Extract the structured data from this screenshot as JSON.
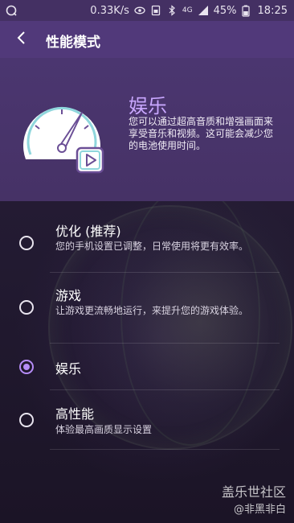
{
  "status_bar": {
    "speed": "0.33K/s",
    "network": "4G",
    "battery": "45%",
    "time": "18:25",
    "icons": [
      "app-notification-icon",
      "eye-icon",
      "sd-card-icon",
      "bluetooth-icon",
      "signal-icon",
      "battery-icon"
    ]
  },
  "app_bar": {
    "title": "性能模式",
    "back_icon": "chevron-left-icon"
  },
  "header": {
    "illustration_icon": "speedometer-play-icon",
    "mode_title": "娱乐",
    "mode_description": "您可以通过超高音质和增强画面来享受音乐和视频。这可能会减少您的电池使用时间。"
  },
  "options": [
    {
      "title": "优化 (推荐)",
      "description": "您的手机设置已调整，日常使用将更有效率。",
      "selected": false
    },
    {
      "title": "游戏",
      "description": "让游戏更流畅地运行，来提升您的游戏体验。",
      "selected": false
    },
    {
      "title": "娱乐",
      "description": "",
      "selected": true
    },
    {
      "title": "高性能",
      "description": "体验最高画质显示设置",
      "selected": false
    }
  ],
  "watermark": {
    "line1": "盖乐世社区",
    "line2": "@非黑非白"
  },
  "colors": {
    "accent": "#b58cf7",
    "app_bar": "#51397a",
    "status_bar": "#443063",
    "header": "#4b3670",
    "background": "#221a31"
  }
}
